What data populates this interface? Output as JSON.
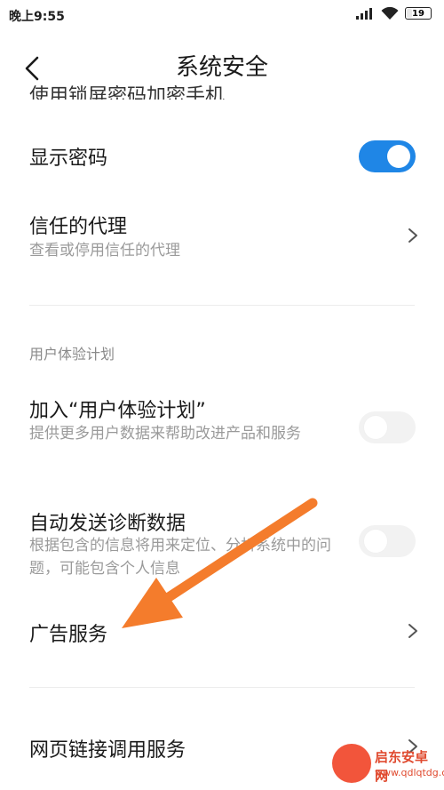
{
  "status_bar": {
    "time": "晚上9:55",
    "signal_icon": "signal-icon",
    "wifi_icon": "wifi-icon",
    "battery_level": "19"
  },
  "header": {
    "back_icon": "back-arrow-icon",
    "title": "系统安全"
  },
  "cut_item": {
    "text": "使用锁屏密码加密手机"
  },
  "rows": {
    "show_password": {
      "title": "显示密码",
      "toggle": "on"
    },
    "trust_agents": {
      "title": "信任的代理",
      "subtitle": "查看或停用信任的代理"
    },
    "ux_section_label": "用户体验计划",
    "join_ux": {
      "title": "加入“用户体验计划”",
      "subtitle": "提供更多用户数据来帮助改进产品和服务",
      "toggle": "off"
    },
    "auto_diag": {
      "title": "自动发送诊断数据",
      "subtitle": "根据包含的信息将用来定位、分析系统中的问题，可能包含个人信息",
      "toggle": "off"
    },
    "ad_service": {
      "title": "广告服务"
    },
    "web_link": {
      "title": "网页链接调用服务"
    }
  },
  "annotation": {
    "color": "#f47c2c"
  },
  "watermark": {
    "name": "启东安卓网",
    "url": "www.qdlqtdg.com"
  },
  "colors": {
    "toggle_on": "#1f86e6",
    "toggle_off": "#f2f2f2",
    "subtitle": "#9a9a9a"
  }
}
